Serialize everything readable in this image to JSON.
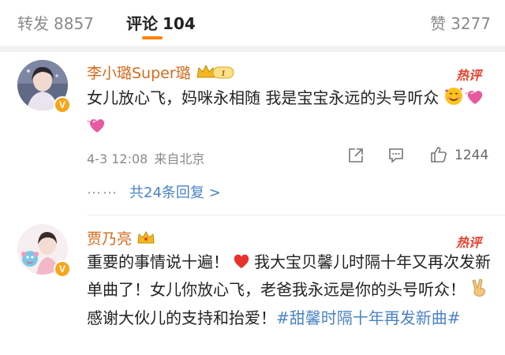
{
  "tabs": {
    "forward": {
      "label": "转发",
      "count": "8857"
    },
    "comment": {
      "label": "评论",
      "count": "104"
    },
    "like": {
      "label": "赞",
      "count": "3277"
    }
  },
  "comments": [
    {
      "username": "李小璐Super璐",
      "level": "1",
      "hot_tag": "热评",
      "text": "女儿放心飞，妈咪永相随 我是宝宝永远的头号听众",
      "time": "4-3 12:08",
      "location": "来自北京",
      "likes": "1244",
      "replies_label": "共24条回复 >",
      "icons": [
        "verified-badge",
        "crown-icon",
        "smiling-hearts-emoji",
        "sparkling-heart-emoji",
        "sparkling-heart-emoji",
        "share-icon",
        "comment-icon",
        "thumbs-up-icon"
      ]
    },
    {
      "username": "贾乃亮",
      "hot_tag": "热评",
      "text_part1": "重要的事情说十遍！",
      "text_part2": "我大宝贝馨儿时隔十年又再次发新单曲了！女儿你放心飞，老爸我永远是你的头号听众！",
      "text_part3": "感谢大伙儿的支持和抬爱！",
      "hashtag": "#甜馨时隔十年再发新曲#",
      "icons": [
        "verified-badge",
        "crown-icon",
        "red-heart-emoji",
        "victory-hand-emoji"
      ]
    }
  ],
  "colors": {
    "accent": "#ff8200",
    "username": "#d46a1e",
    "link": "#4a83c2",
    "hot": "#e8412b"
  }
}
